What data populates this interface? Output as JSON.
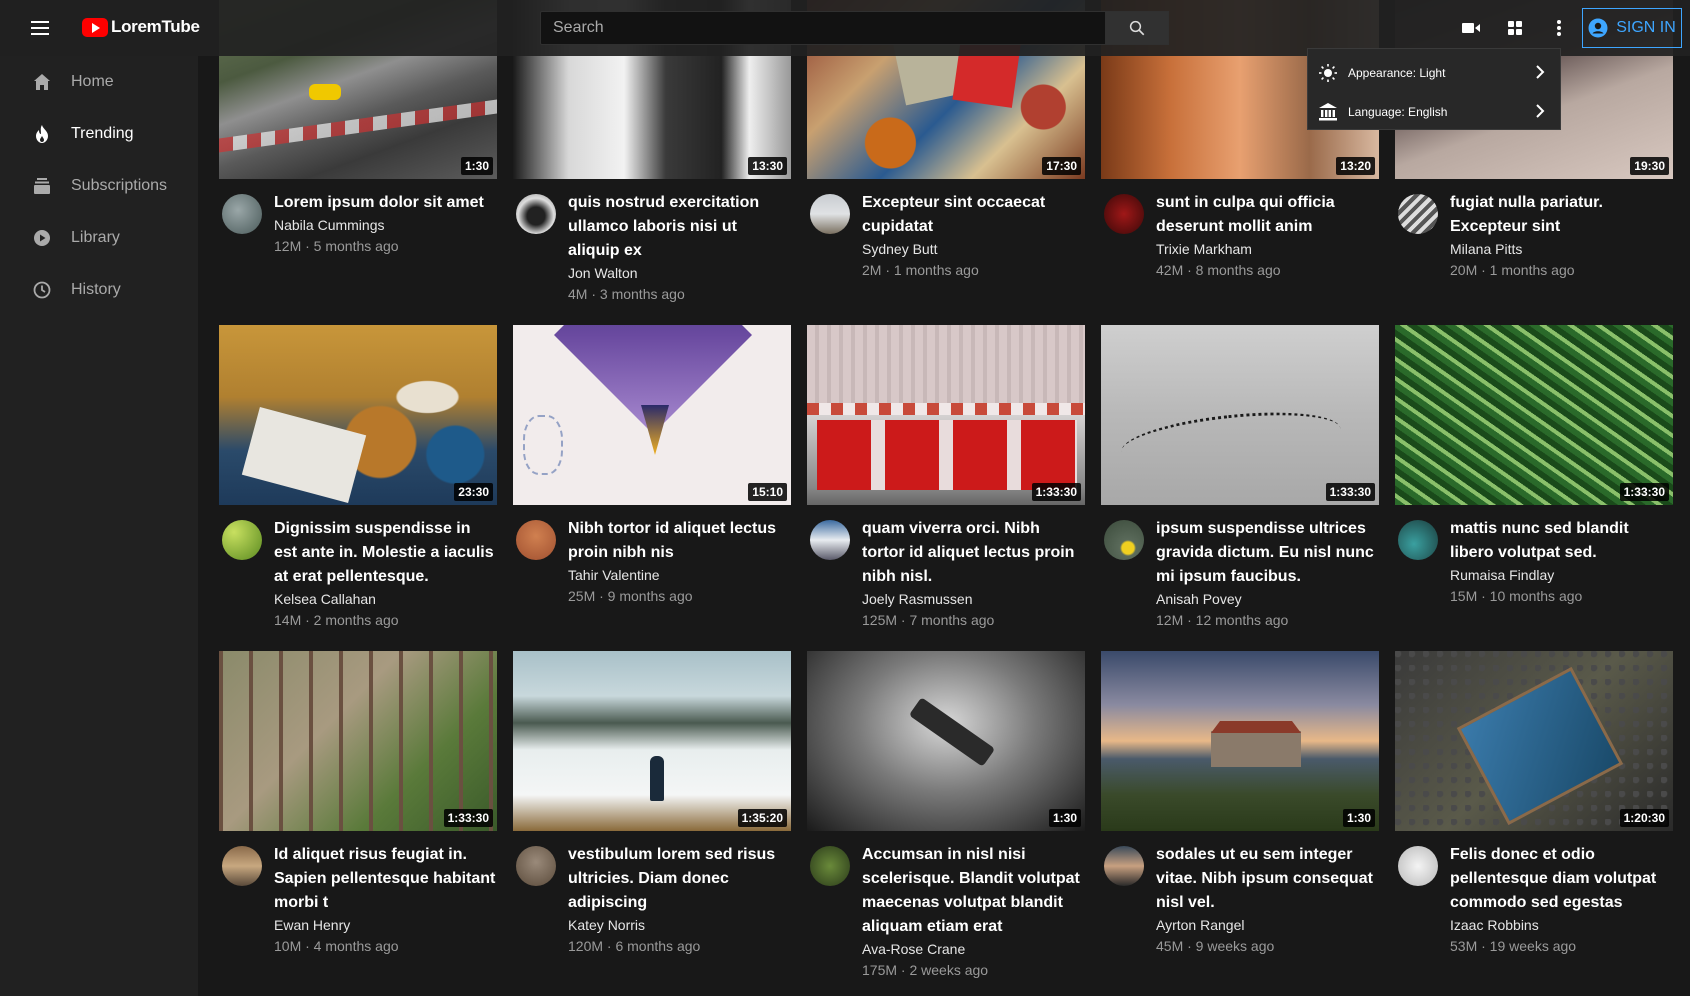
{
  "header": {
    "app_name": "LoremTube",
    "search_placeholder": "Search",
    "signin_label": "SIGN IN"
  },
  "sidebar": {
    "items": [
      {
        "label": "Home",
        "icon": "home-icon"
      },
      {
        "label": "Trending",
        "icon": "fire-icon",
        "active": true
      },
      {
        "label": "Subscriptions",
        "icon": "subscriptions-icon"
      },
      {
        "label": "Library",
        "icon": "play-circle-icon"
      },
      {
        "label": "History",
        "icon": "clock-icon"
      }
    ]
  },
  "menu": {
    "items": [
      {
        "label": "Appearance: Light",
        "icon": "sun-icon"
      },
      {
        "label": "Language: English",
        "icon": "bank-icon"
      }
    ]
  },
  "videos": [
    {
      "title": "Lorem ipsum dolor sit amet",
      "channel": "Nabila Cummings",
      "stats": "12M · 5 months ago",
      "duration": "1:30"
    },
    {
      "title": "quis nostrud exercitation ullamco laboris nisi ut aliquip ex",
      "channel": "Jon Walton",
      "stats": "4M · 3 months ago",
      "duration": "13:30"
    },
    {
      "title": "Excepteur sint occaecat cupidatat",
      "channel": "Sydney Butt",
      "stats": "2M · 1 months ago",
      "duration": "17:30"
    },
    {
      "title": "sunt in culpa qui officia deserunt mollit anim",
      "channel": "Trixie Markham",
      "stats": "42M · 8 months ago",
      "duration": "13:20"
    },
    {
      "title": "fugiat nulla pariatur. Excepteur sint",
      "channel": "Milana Pitts",
      "stats": "20M · 1 months ago",
      "duration": "19:30"
    },
    {
      "title": "Dignissim suspendisse in est ante in. Molestie a iaculis at erat pellentesque.",
      "channel": "Kelsea Callahan",
      "stats": "14M · 2 months ago",
      "duration": "23:30"
    },
    {
      "title": "Nibh tortor id aliquet lectus proin nibh nis",
      "channel": "Tahir Valentine",
      "stats": "25M · 9 months ago",
      "duration": "15:10"
    },
    {
      "title": "quam viverra orci. Nibh tortor id aliquet lectus proin nibh nisl.",
      "channel": "Joely Rasmussen",
      "stats": "125M · 7 months ago",
      "duration": "1:33:30"
    },
    {
      "title": "ipsum suspendisse ultrices gravida dictum. Eu nisl nunc mi ipsum faucibus.",
      "channel": "Anisah Povey",
      "stats": "12M · 12 months ago",
      "duration": "1:33:30"
    },
    {
      "title": "mattis nunc sed blandit libero volutpat sed.",
      "channel": "Rumaisa Findlay",
      "stats": "15M · 10 months ago",
      "duration": "1:33:30"
    },
    {
      "title": "Id aliquet risus feugiat in. Sapien pellentesque habitant morbi t",
      "channel": "Ewan Henry",
      "stats": "10M · 4 months ago",
      "duration": "1:33:30"
    },
    {
      "title": "vestibulum lorem sed risus ultricies. Diam donec adipiscing",
      "channel": "Katey Norris",
      "stats": "120M · 6 months ago",
      "duration": "1:35:20"
    },
    {
      "title": "Accumsan in nisl nisi scelerisque. Blandit volutpat maecenas volutpat blandit aliquam etiam erat",
      "channel": "Ava-Rose Crane",
      "stats": "175M · 2 weeks ago",
      "duration": "1:30"
    },
    {
      "title": "sodales ut eu sem integer vitae. Nibh ipsum consequat nisl vel.",
      "channel": "Ayrton Rangel",
      "stats": "45M · 9 weeks ago",
      "duration": "1:30"
    },
    {
      "title": "Felis donec et odio pellentesque diam volutpat commodo sed egestas",
      "channel": "Izaac Robbins",
      "stats": "53M · 19 weeks ago",
      "duration": "1:20:30"
    }
  ]
}
